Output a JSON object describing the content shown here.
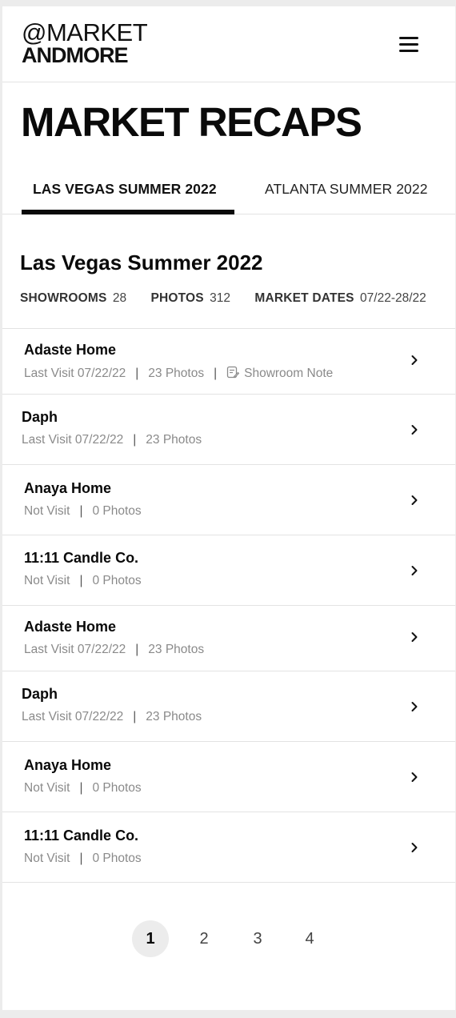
{
  "header": {
    "logo_line1": "@MARKET",
    "logo_line2": "ANDMORE",
    "menu_icon": "hamburger-menu-icon"
  },
  "page": {
    "title": "MARKET RECAPS"
  },
  "tabs": [
    {
      "label": "LAS VEGAS SUMMER 2022",
      "active": true
    },
    {
      "label": "ATLANTA SUMMER 2022",
      "active": false
    }
  ],
  "section": {
    "title": "Las Vegas Summer 2022",
    "stats": [
      {
        "label": "SHOWROOMS",
        "value": "28"
      },
      {
        "label": "PHOTOS",
        "value": "312"
      },
      {
        "label": "MARKET DATES",
        "value": "07/22-28/22"
      }
    ]
  },
  "showrooms": [
    {
      "name": "Adaste Home",
      "visit": "Last Visit 07/22/22",
      "photos": "23 Photos",
      "note": "Showroom Note"
    },
    {
      "name": "Daph",
      "visit": "Last Visit 07/22/22",
      "photos": "23 Photos"
    },
    {
      "name": "Anaya Home",
      "visit": "Not Visit",
      "photos": "0 Photos"
    },
    {
      "name": "11:11 Candle Co.",
      "visit": "Not Visit",
      "photos": "0 Photos"
    },
    {
      "name": "Adaste Home",
      "visit": "Last Visit 07/22/22",
      "photos": "23 Photos"
    },
    {
      "name": "Daph",
      "visit": "Last Visit 07/22/22",
      "photos": "23 Photos"
    },
    {
      "name": "Anaya Home",
      "visit": "Not Visit",
      "photos": "0 Photos"
    },
    {
      "name": "11:11 Candle Co.",
      "visit": "Not Visit",
      "photos": "0 Photos"
    }
  ],
  "pagination": {
    "pages": [
      "1",
      "2",
      "3",
      "4"
    ],
    "current": "1"
  },
  "colors": {
    "text": "#0a0a0a",
    "muted": "#8a8a8a",
    "divider": "#e3e3e3",
    "active_page_bg": "#ececec"
  }
}
